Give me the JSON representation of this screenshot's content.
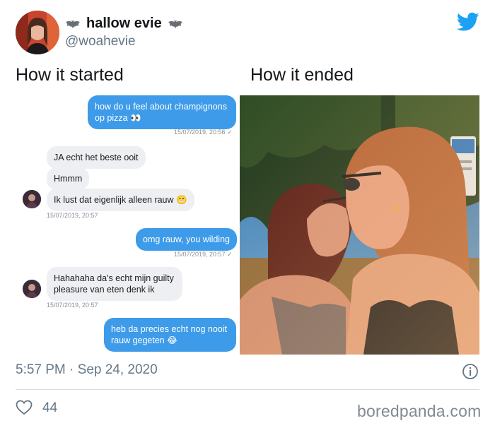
{
  "header": {
    "display_name": "hallow evie",
    "handle": "@woahevie",
    "left_icon": "bat-icon",
    "right_icon": "bat-icon",
    "logo": "twitter-bird-icon"
  },
  "captions": {
    "left": "How it started",
    "right": "How it ended"
  },
  "chat": {
    "messages": [
      {
        "direction": "out",
        "text": "how do u feel about champignons op pizza 👀",
        "time": "15/07/2019, 20:56"
      },
      {
        "direction": "in",
        "text": "JA echt het beste ooit",
        "time": ""
      },
      {
        "direction": "in",
        "text": "Hmmm",
        "time": ""
      },
      {
        "direction": "in",
        "text": "Ik lust dat eigenlijk alleen rauw 😬",
        "time": "15/07/2019, 20:57"
      },
      {
        "direction": "out",
        "text": "omg rauw, you wilding",
        "time": "15/07/2019, 20:57"
      },
      {
        "direction": "in",
        "text": "Hahahaha da's echt mijn guilty pleasure van eten denk ik",
        "time": "15/07/2019, 20:57"
      },
      {
        "direction": "out",
        "text": "heb da precies echt nog nooit rauw gegeten 😂",
        "time": ""
      }
    ]
  },
  "footer": {
    "timestamp": "5:57 PM · Sep 24, 2020",
    "likes": "44",
    "watermark": "boredpanda.com"
  },
  "colors": {
    "twitter_blue": "#1da1f2",
    "outgoing_bubble": "#3d9be9",
    "incoming_bubble": "#eeeff2",
    "muted_text": "#657786"
  }
}
